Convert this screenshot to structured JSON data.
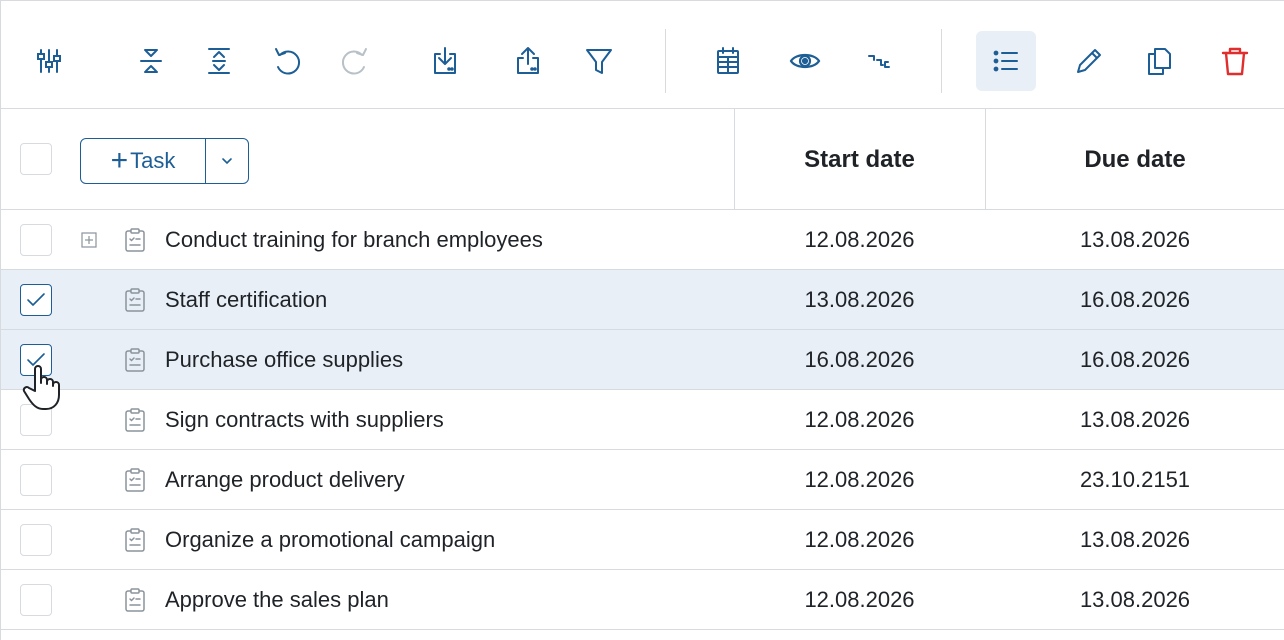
{
  "toolbar": {
    "buttons": [
      {
        "icon": "sliders-icon",
        "title": "Settings"
      },
      {
        "icon": "collapse-icon",
        "title": "Collapse"
      },
      {
        "icon": "expand-icon",
        "title": "Expand"
      },
      {
        "icon": "undo-icon",
        "title": "Undo"
      },
      {
        "icon": "redo-icon",
        "title": "Redo"
      },
      {
        "icon": "import-icon",
        "title": "Import"
      },
      {
        "icon": "export-icon",
        "title": "Export"
      },
      {
        "icon": "filter-icon",
        "title": "Filter"
      },
      {
        "icon": "calendar-icon",
        "title": "Calendar"
      },
      {
        "icon": "eye-icon",
        "title": "View"
      },
      {
        "icon": "critical-path-icon",
        "title": "Critical path"
      },
      {
        "icon": "list-icon",
        "title": "List",
        "active": true
      },
      {
        "icon": "pencil-icon",
        "title": "Edit"
      },
      {
        "icon": "copy-icon",
        "title": "Copy"
      },
      {
        "icon": "trash-icon",
        "title": "Delete"
      }
    ],
    "colors": {
      "primary": "#1d5e96",
      "disabled": "#b8c0c8",
      "danger": "#e02d2d",
      "active_bg": "#e8eff6"
    }
  },
  "header": {
    "add_task_label": "Task",
    "add_task_plus": "+",
    "columns": {
      "start": "Start date",
      "due": "Due date"
    }
  },
  "rows": [
    {
      "name": "Conduct training for branch employees",
      "start": "12.08.2026",
      "due": "13.08.2026",
      "checked": false,
      "expandable": true
    },
    {
      "name": "Staff certification",
      "start": "13.08.2026",
      "due": "16.08.2026",
      "checked": true,
      "expandable": false
    },
    {
      "name": "Purchase office supplies",
      "start": "16.08.2026",
      "due": "16.08.2026",
      "checked": true,
      "expandable": false
    },
    {
      "name": "Sign contracts with suppliers",
      "start": "12.08.2026",
      "due": "13.08.2026",
      "checked": false,
      "expandable": false
    },
    {
      "name": "Arrange product delivery",
      "start": "12.08.2026",
      "due": "23.10.2151",
      "checked": false,
      "expandable": false
    },
    {
      "name": "Organize a promotional campaign",
      "start": "12.08.2026",
      "due": "13.08.2026",
      "checked": false,
      "expandable": false
    },
    {
      "name": "Approve the sales plan",
      "start": "12.08.2026",
      "due": "13.08.2026",
      "checked": false,
      "expandable": false
    }
  ]
}
